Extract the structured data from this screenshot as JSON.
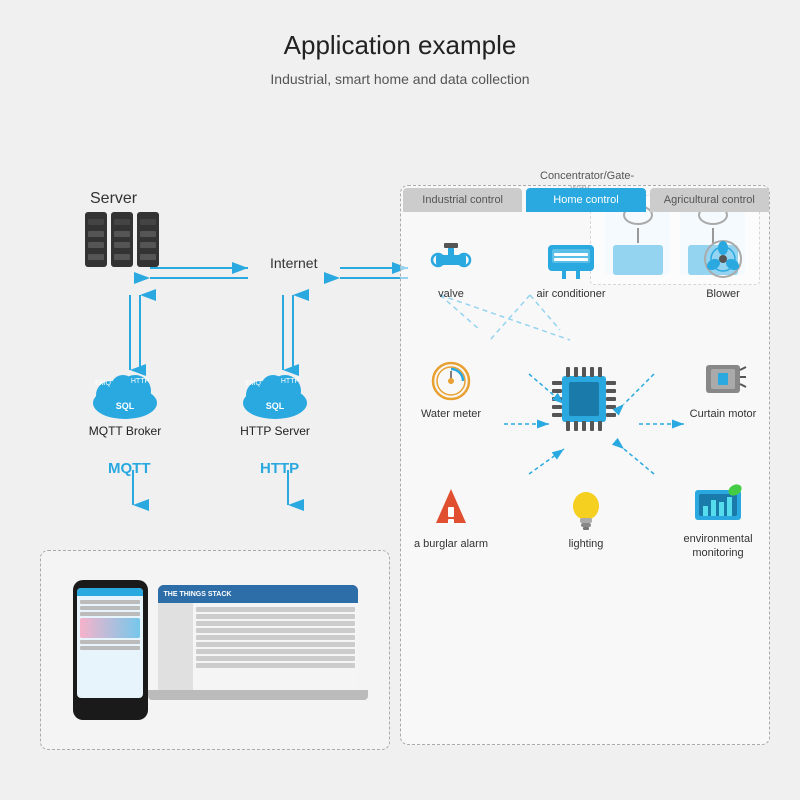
{
  "title": "Application example",
  "subtitle": "Industrial, smart home and data collection",
  "server": {
    "label": "Server"
  },
  "internet": {
    "label": "Internet"
  },
  "concentrator": {
    "label": "Concentrator/Gate-way"
  },
  "brokers": {
    "mqtt": {
      "label": "MQTT Broker",
      "arrow_label": "MQTT"
    },
    "http": {
      "label": "HTTP Server",
      "arrow_label": "HTTP"
    }
  },
  "tabs": [
    {
      "label": "Industrial control",
      "active": false
    },
    {
      "label": "Home control",
      "active": true
    },
    {
      "label": "Agricultural control",
      "active": false
    }
  ],
  "controls": [
    {
      "id": "valve",
      "label": "valve",
      "position": "top-left"
    },
    {
      "id": "air-conditioner",
      "label": "air conditioner",
      "position": "top-center"
    },
    {
      "id": "blower",
      "label": "Blower",
      "position": "top-right"
    },
    {
      "id": "water-meter",
      "label": "Water meter",
      "position": "mid-left"
    },
    {
      "id": "chip",
      "label": "",
      "position": "mid-center"
    },
    {
      "id": "curtain-motor",
      "label": "Curtain motor",
      "position": "mid-right"
    },
    {
      "id": "burglar-alarm",
      "label": "a burglar alarm",
      "position": "bot-left"
    },
    {
      "id": "lighting",
      "label": "lighting",
      "position": "bot-center"
    },
    {
      "id": "environmental-monitoring",
      "label": "environmental monitoring",
      "position": "bot-right"
    }
  ]
}
